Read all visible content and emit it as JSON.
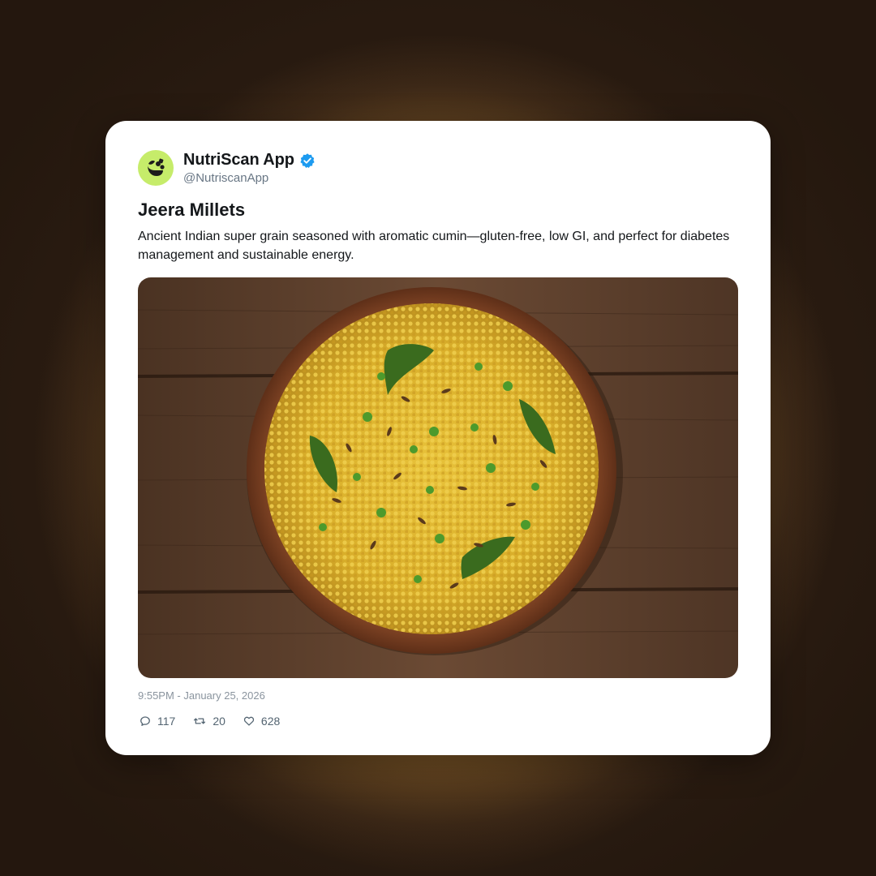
{
  "post": {
    "account": {
      "name": "NutriScan App",
      "handle": "@NutriscanApp",
      "verified": true,
      "avatar_icon": "leaf-logo-icon",
      "avatar_color": "#c6ec6a",
      "verified_color": "#1d9bf0"
    },
    "title": "Jeera Millets",
    "description": "Ancient Indian super grain seasoned with aromatic cumin—gluten-free, low GI, and perfect for diabetes management and sustainable energy.",
    "image_icon": "millet-bowl-photo",
    "timestamp": "9:55PM - January 25, 2026",
    "stats": {
      "replies": "117",
      "retweets": "20",
      "likes": "628"
    },
    "action_icons": [
      "reply-icon",
      "retweet-icon",
      "like-icon"
    ]
  }
}
